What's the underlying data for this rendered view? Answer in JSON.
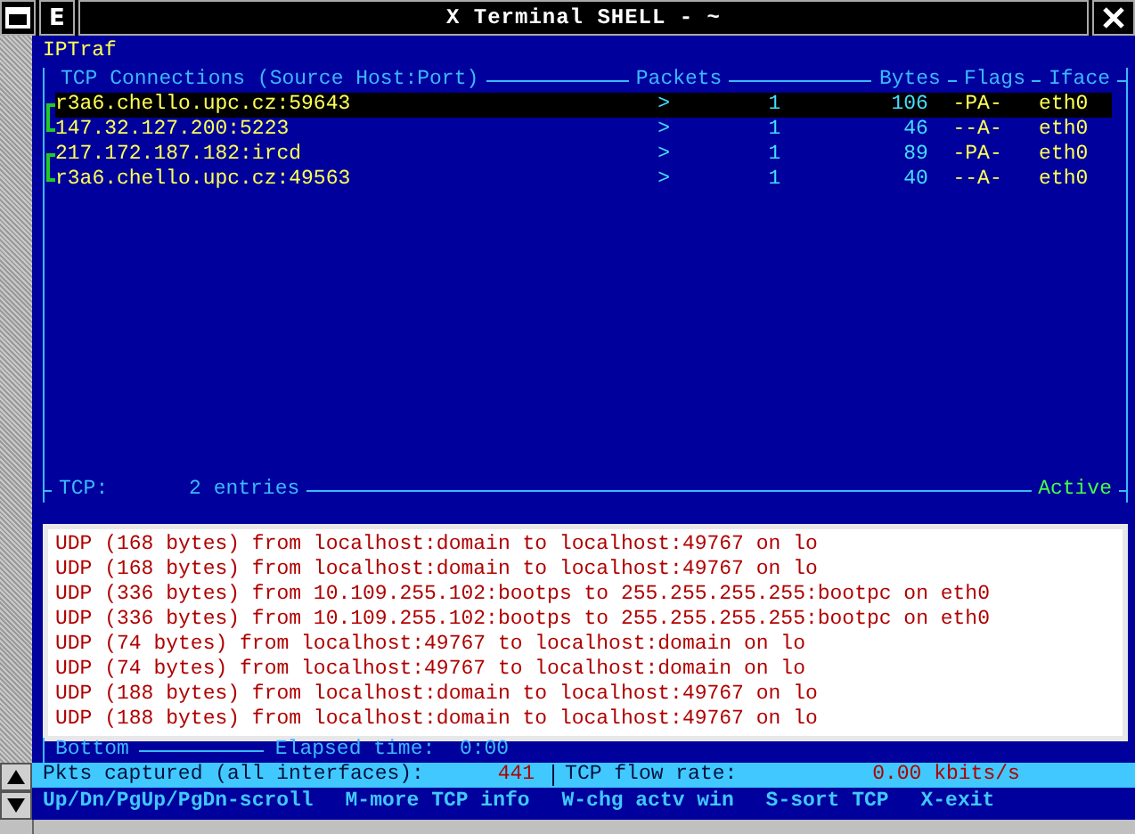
{
  "window": {
    "title": "X Terminal SHELL - ~",
    "menu_key": "E"
  },
  "app_title": "IPTraf",
  "tcp_table": {
    "columns": [
      "TCP Connections (Source Host:Port)",
      "Packets",
      "Bytes",
      "Flags",
      "Iface"
    ],
    "rows": [
      {
        "host": "r3a6.chello.upc.cz:59643",
        "arrow": ">",
        "packets": "1",
        "bytes": "106",
        "flags": "-PA-",
        "iface": "eth0",
        "selected": true,
        "kind": "opener"
      },
      {
        "host": "147.32.127.200:5223",
        "arrow": ">",
        "packets": "1",
        "bytes": "46",
        "flags": "--A-",
        "iface": "eth0",
        "selected": false,
        "kind": "closer"
      },
      {
        "host": "217.172.187.182:ircd",
        "arrow": ">",
        "packets": "1",
        "bytes": "89",
        "flags": "-PA-",
        "iface": "eth0",
        "selected": false,
        "kind": "opener"
      },
      {
        "host": "r3a6.chello.upc.cz:49563",
        "arrow": ">",
        "packets": "1",
        "bytes": "40",
        "flags": "--A-",
        "iface": "eth0",
        "selected": false,
        "kind": "closer"
      }
    ],
    "footer_label": "TCP:",
    "entries": "2 entries",
    "status": "Active"
  },
  "udp_log": [
    "UDP (168 bytes) from localhost:domain to localhost:49767 on lo",
    "UDP (168 bytes) from localhost:domain to localhost:49767 on lo",
    "UDP (336 bytes) from 10.109.255.102:bootps to 255.255.255.255:bootpc on eth0",
    "UDP (336 bytes) from 10.109.255.102:bootps to 255.255.255.255:bootpc on eth0",
    "UDP (74 bytes) from localhost:49767 to localhost:domain on lo",
    "UDP (74 bytes) from localhost:49767 to localhost:domain on lo",
    "UDP (188 bytes) from localhost:domain to localhost:49767 on lo",
    "UDP (188 bytes) from localhost:domain to localhost:49767 on lo"
  ],
  "udp_footer": {
    "position": "Bottom",
    "elapsed_label": "Elapsed time:",
    "elapsed": "0:00"
  },
  "status_bar": {
    "captured_label": "Pkts captured (all interfaces):",
    "captured": "441",
    "flow_label": "TCP flow rate:",
    "flow": "0.00 kbits/s"
  },
  "help_bar": [
    "Up/Dn/PgUp/PgDn-scroll",
    "M-more TCP info",
    "W-chg actv win",
    "S-sort TCP",
    "X-exit"
  ]
}
